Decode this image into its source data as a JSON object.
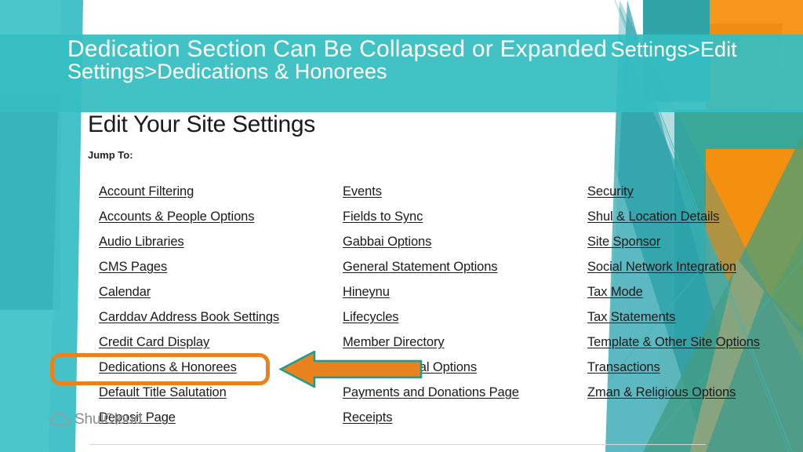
{
  "slide": {
    "title_main": "Dedication Section Can Be Collapsed or Expanded",
    "title_breadcrumb": "Settings>Edit Settings>Dedications & Honorees",
    "band_color": "#35BDC2"
  },
  "page": {
    "heading": "Edit Your Site Settings",
    "jump_to_label": "Jump To:"
  },
  "columns": [
    {
      "items": [
        "Account Filtering",
        "Accounts & People Options",
        "Audio Libraries",
        "CMS Pages",
        "Calendar",
        "Carddav Address Book Settings",
        "Credit Card Display",
        "Dedications & Honorees",
        "Default Title Salutation",
        "Deposit Page"
      ]
    },
    {
      "items": [
        "Events",
        "Fields to Sync",
        "Gabbai Options",
        "General Statement Options",
        "Hineynu",
        "Lifecycles",
        "Member Directory",
        "Other Financial Options",
        "Payments and Donations Page",
        "Receipts"
      ]
    },
    {
      "items": [
        "Security",
        "Shul & Location Details",
        "Site Sponsor",
        "Social Network Integration",
        "Tax Mode",
        "Tax Statements",
        "Template & Other Site Options",
        "Transactions",
        "Zman & Religious Options"
      ]
    }
  ],
  "annotation": {
    "highlight_target": "Dedications & Honorees",
    "callout_border_color": "#E8821E",
    "arrow_fill_color": "#E8821E",
    "arrow_stroke_color": "#1F9C8E",
    "arrow_direction": "left"
  },
  "logo": {
    "text": "ShulCloud",
    "icon": "cloud-icon"
  }
}
